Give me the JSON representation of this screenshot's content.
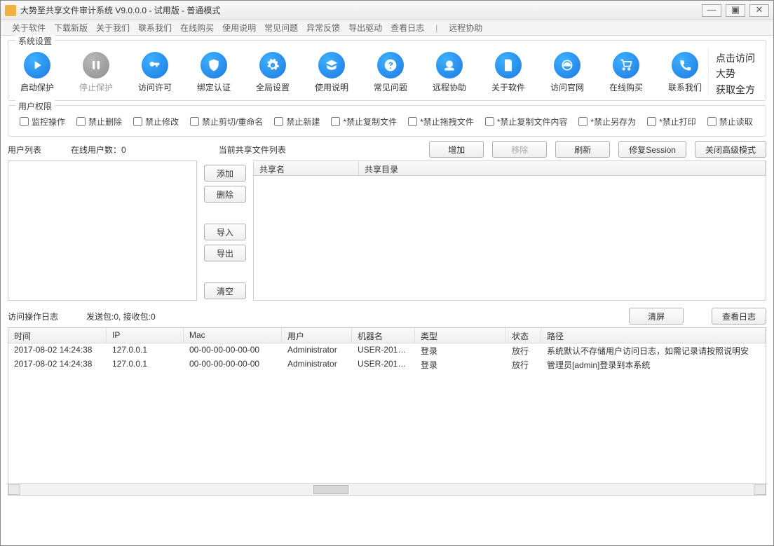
{
  "window": {
    "title": "大势至共享文件审计系统 V9.0.0.0 - 试用版 - 普通模式"
  },
  "menu": {
    "items": [
      "关于软件",
      "下载新版",
      "关于我们",
      "联系我们",
      "在线购买",
      "使用说明",
      "常见问题",
      "异常反馈",
      "导出驱动",
      "查看日志"
    ],
    "remote": "远程协助"
  },
  "toolbar": {
    "legend": "系统设置",
    "items": [
      {
        "id": "start-protect",
        "label": "启动保护",
        "icon": "play"
      },
      {
        "id": "stop-protect",
        "label": "停止保护",
        "icon": "pause",
        "disabled": true
      },
      {
        "id": "access-permit",
        "label": "访问许可",
        "icon": "key"
      },
      {
        "id": "bind-auth",
        "label": "绑定认证",
        "icon": "shield"
      },
      {
        "id": "global-settings",
        "label": "全局设置",
        "icon": "gear"
      },
      {
        "id": "usage",
        "label": "使用说明",
        "icon": "grad"
      },
      {
        "id": "faq",
        "label": "常见问题",
        "icon": "question"
      },
      {
        "id": "remote-assist",
        "label": "远程协助",
        "icon": "globe-hand"
      },
      {
        "id": "about",
        "label": "关于软件",
        "icon": "doc"
      },
      {
        "id": "visit-site",
        "label": "访问官网",
        "icon": "ie"
      },
      {
        "id": "buy-online",
        "label": "在线购买",
        "icon": "cart"
      },
      {
        "id": "contact",
        "label": "联系我们",
        "icon": "phone"
      }
    ],
    "promo_line1": "点击访问大势",
    "promo_line2": "获取全方位"
  },
  "perm": {
    "legend": "用户权限",
    "checks": [
      "监控操作",
      "禁止删除",
      "禁止修改",
      "禁止剪切/重命名",
      "禁止新建",
      "*禁止复制文件",
      "*禁止拖拽文件",
      "*禁止复制文件内容",
      "*禁止另存为",
      "*禁止打印",
      "禁止读取"
    ]
  },
  "mid": {
    "userlist_label": "用户列表",
    "online_label": "在线用户数：0",
    "sharelist_label": "当前共享文件列表",
    "btn_add": "增加",
    "btn_remove": "移除",
    "btn_refresh": "刷新",
    "btn_repair": "修复Session",
    "btn_close_adv": "关闭高级模式",
    "ul_add": "添加",
    "ul_del": "删除",
    "ul_import": "导入",
    "ul_export": "导出",
    "ul_clear": "清空",
    "share_col_name": "共享名",
    "share_col_dir": "共享目录"
  },
  "log": {
    "label": "访问操作日志",
    "packets": "发送包:0, 接收包:0",
    "btn_clear": "清屏",
    "btn_view": "查看日志",
    "columns": [
      "时间",
      "IP",
      "Mac",
      "用户",
      "机器名",
      "类型",
      "状态",
      "路径"
    ],
    "rows": [
      {
        "time": "2017-08-02 14:24:38",
        "ip": "127.0.0.1",
        "mac": "00-00-00-00-00-00",
        "user": "Administrator",
        "host": "USER-2017...",
        "type": "登录",
        "status": "放行",
        "path": "系统默认不存储用户访问日志，如需记录请按照说明安"
      },
      {
        "time": "2017-08-02 14:24:38",
        "ip": "127.0.0.1",
        "mac": "00-00-00-00-00-00",
        "user": "Administrator",
        "host": "USER-2017...",
        "type": "登录",
        "status": "放行",
        "path": "管理员[admin]登录到本系统"
      }
    ]
  }
}
